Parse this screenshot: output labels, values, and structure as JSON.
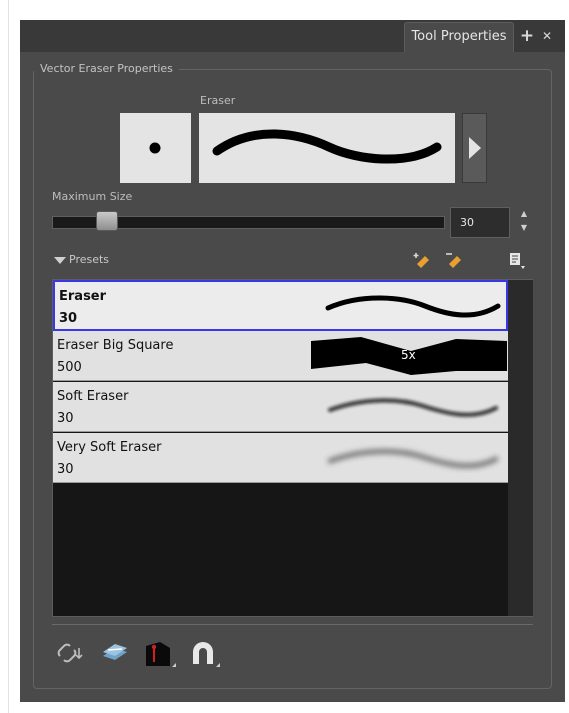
{
  "panel": {
    "tab_label": "Tool Properties",
    "add_tab_glyph": "+",
    "close_tab_glyph": "✕",
    "group_title": "Vector Eraser Properties"
  },
  "eraser": {
    "label": "Eraser",
    "next_button_icon": "triangle-right-icon"
  },
  "max_size": {
    "label": "Maximum Size",
    "value": "30",
    "slider_fraction": 0.1
  },
  "presets": {
    "label": "Presets",
    "toolbar_icons": [
      "new-preset-icon",
      "rename-preset-icon",
      "preset-menu-icon"
    ],
    "items": [
      {
        "name": "Eraser",
        "size": "30",
        "selected": true
      },
      {
        "name": "Eraser Big Square",
        "size": "500",
        "preview_text": "5x",
        "selected": false
      },
      {
        "name": "Soft Eraser",
        "size": "30",
        "selected": false
      },
      {
        "name": "Very Soft Eraser",
        "size": "30",
        "selected": false
      }
    ]
  },
  "bottom_toolbar": {
    "icons": [
      "auto-flatten-icon",
      "draw-behind-icon",
      "pressure-sensitivity-icon",
      "snap-icon"
    ]
  },
  "colors": {
    "panel_bg": "#4a4a4a",
    "selection_border": "#3838e8",
    "icon_accent": "#e8a030"
  }
}
